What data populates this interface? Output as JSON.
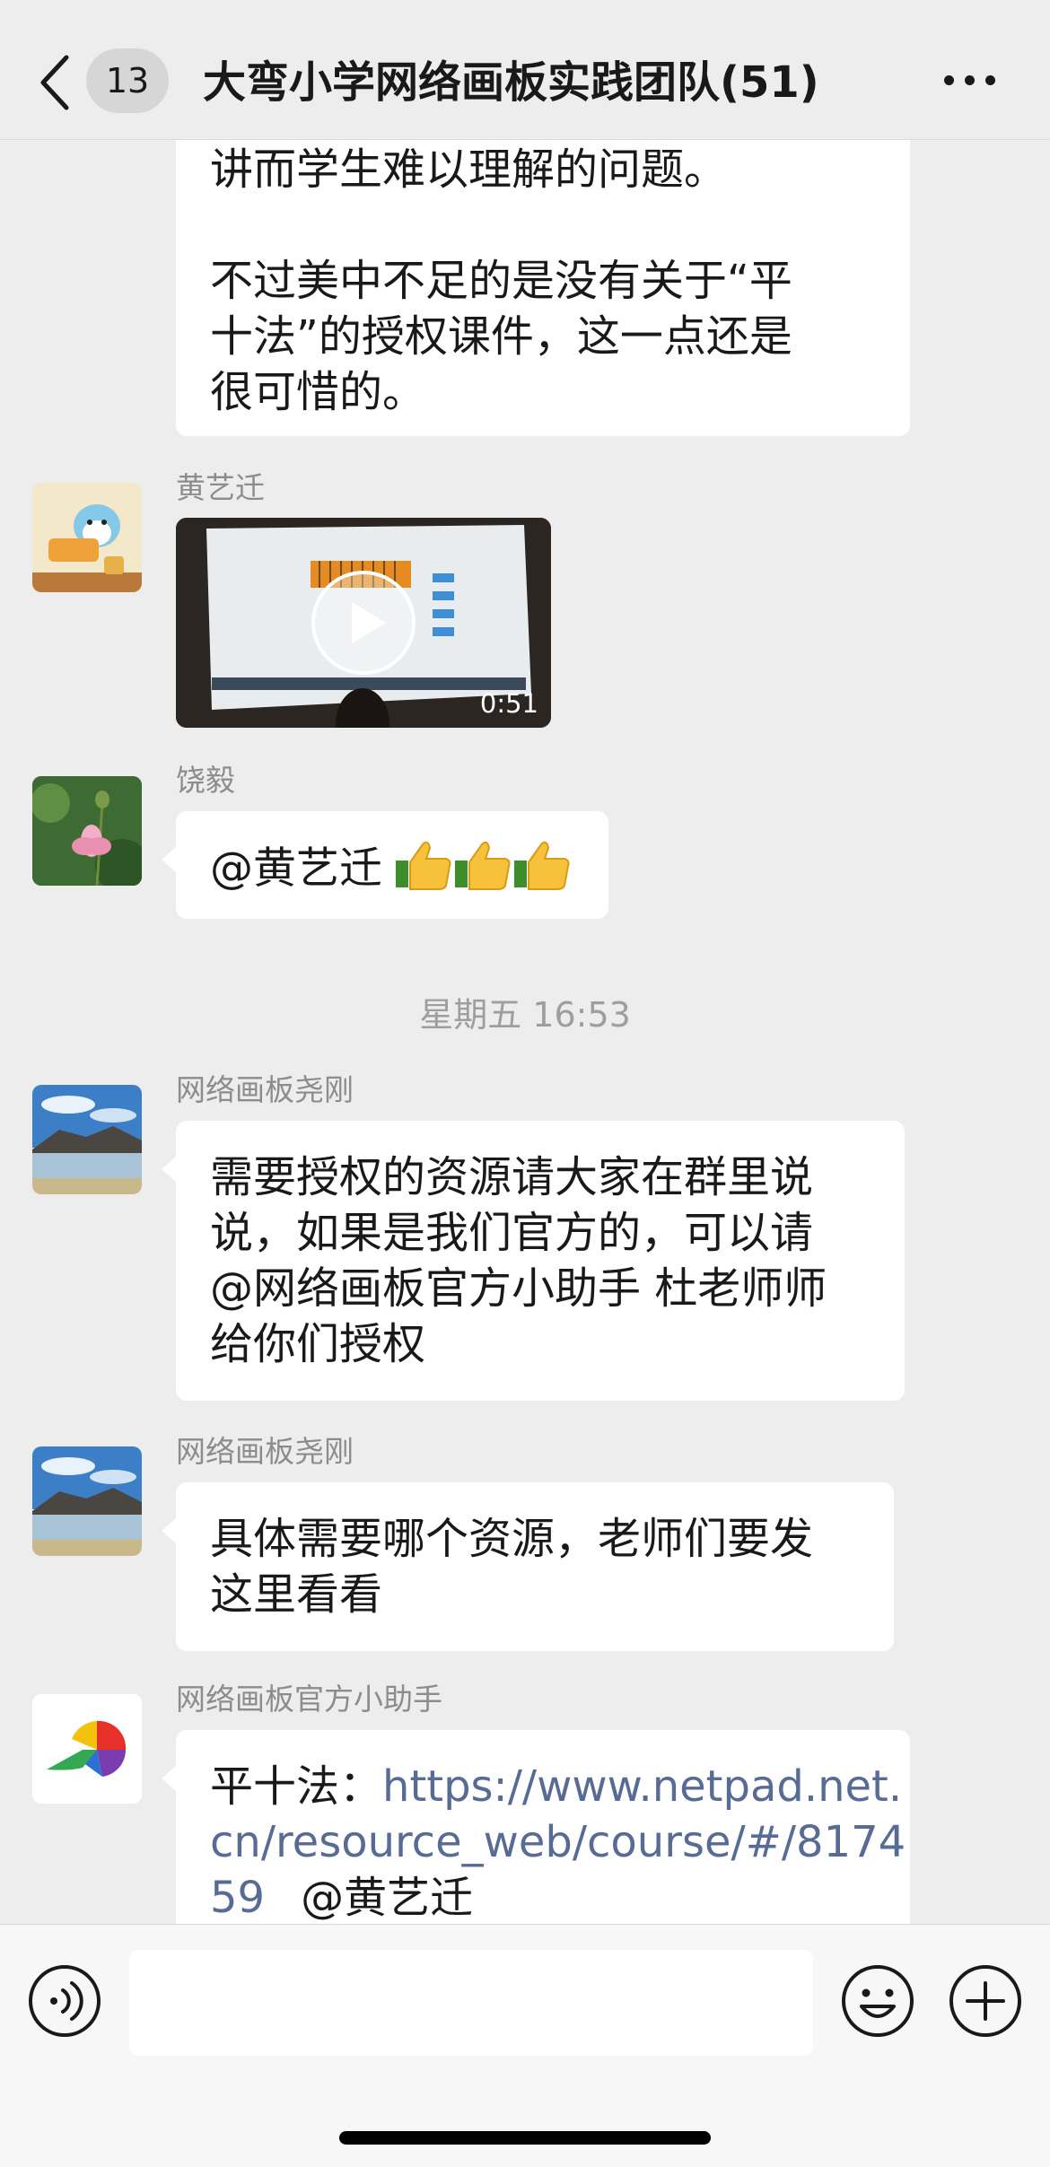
{
  "header": {
    "unread_count": "13",
    "title": "大弯小学网络画板实践团队(51)"
  },
  "messages": {
    "m1": {
      "lines": [
        "讲而学生难以理解的问题。",
        "",
        "不过美中不足的是没有关于“平",
        "十法”的授权课件，这一点还是",
        "很可惜的。"
      ]
    },
    "m2": {
      "sender": "黄艺迁",
      "video_duration": "0:51"
    },
    "m3": {
      "sender": "饶毅",
      "text": "@黄艺迁 ",
      "emoji_name": "thumbs-up-icon"
    },
    "timestamp": "星期五 16:53",
    "m4": {
      "sender": "网络画板尧刚",
      "lines": [
        "需要授权的资源请大家在群里说",
        "说，如果是我们官方的，可以请",
        "@网络画板官方小助手 杜老师师",
        "给你们授权"
      ]
    },
    "m5": {
      "sender": "网络画板尧刚",
      "lines": [
        "具体需要哪个资源，老师们要发",
        "这里看看"
      ]
    },
    "m6": {
      "sender": "网络画板官方小助手",
      "prefix": "平十法：",
      "link_line1": "https://www.netpad.net.",
      "link_line2": "cn/resource_web/course/#/8174",
      "link_line3": "59",
      "mention": "@黄艺迁"
    }
  },
  "colors": {
    "background": "#ededed",
    "bubble": "#ffffff",
    "link": "#576b95",
    "sender": "#8c8c8c"
  }
}
